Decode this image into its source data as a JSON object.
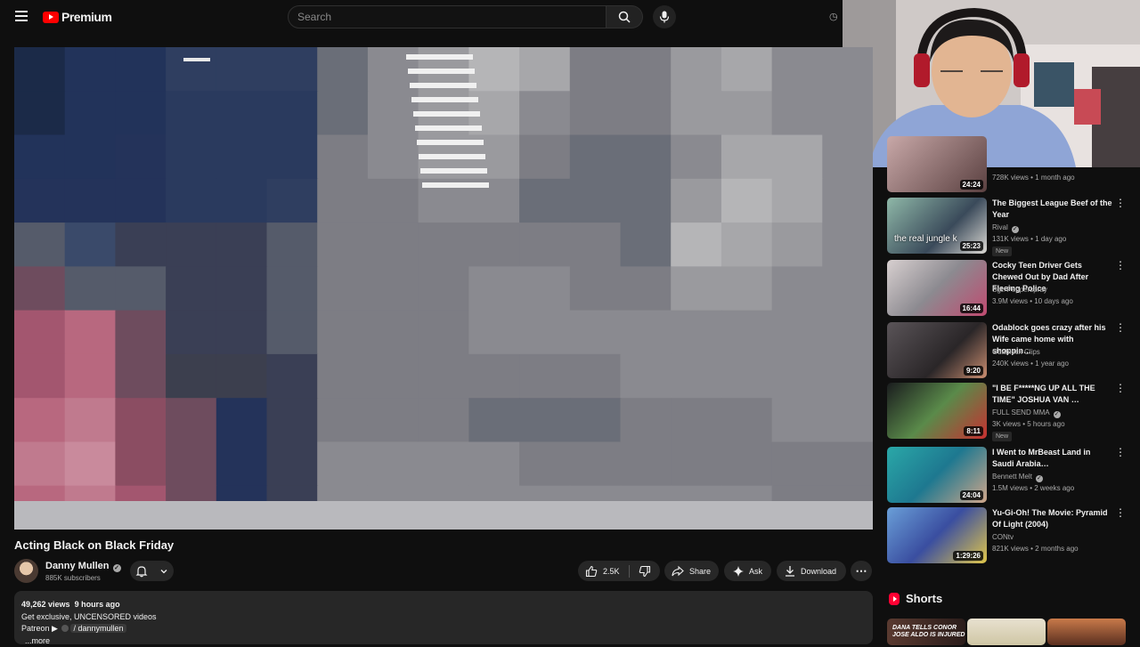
{
  "header": {
    "brand": "Premium",
    "search_placeholder": "Search"
  },
  "video": {
    "title": "Acting Black on Black Friday",
    "channel": "Danny Mullen",
    "subscribers": "885K subscribers",
    "likes": "2.5K",
    "share_label": "Share",
    "ask_label": "Ask",
    "download_label": "Download"
  },
  "description": {
    "views": "49,262 views",
    "age": "9 hours ago",
    "line1": "Get exclusive, UNCENSORED videos",
    "patreon": "Patreon ▶",
    "patreon_handle": "/ dannymullen",
    "more": "...more"
  },
  "recommendations": [
    {
      "title": "",
      "channel": "",
      "meta": "728K views • 1 month ago",
      "duration": "24:24",
      "is_new": false
    },
    {
      "title": "The Biggest League Beef of the Year",
      "channel": "Rival",
      "meta": "131K views • 1 day ago",
      "duration": "25:23",
      "caption": "the real jungle k",
      "is_new": true
    },
    {
      "title": "Cocky Teen Driver Gets Chewed Out by Dad After Fleeing Police",
      "channel": "Sgt. Pepperspray",
      "meta": "3.9M views • 10 days ago",
      "duration": "16:44",
      "is_new": false
    },
    {
      "title": "Odablock goes crazy after his Wife came home with shoppin…",
      "channel": "Odablock Clips",
      "meta": "240K views • 1 year ago",
      "duration": "9:20",
      "is_new": false
    },
    {
      "title": "\"I BE F*****NG UP ALL THE TIME\" JOSHUA VAN …",
      "channel": "FULL SEND MMA",
      "meta": "3K views • 5 hours ago",
      "duration": "8:11",
      "is_new": true
    },
    {
      "title": "I Went to MrBeast Land in Saudi Arabia…",
      "channel": "Bennett Melt",
      "meta": "1.5M views • 2 weeks ago",
      "duration": "24:04",
      "is_new": false
    },
    {
      "title": "Yu-Gi-Oh! The Movie: Pyramid Of Light (2004)",
      "channel": "CONtv",
      "meta": "821K views • 2 months ago",
      "duration": "1:29:26",
      "is_new": false
    }
  ],
  "new_label": "New",
  "shorts": {
    "title": "Shorts",
    "first_caption": "DANA TELLS CONOR JOSE ALDO IS INJURED"
  }
}
